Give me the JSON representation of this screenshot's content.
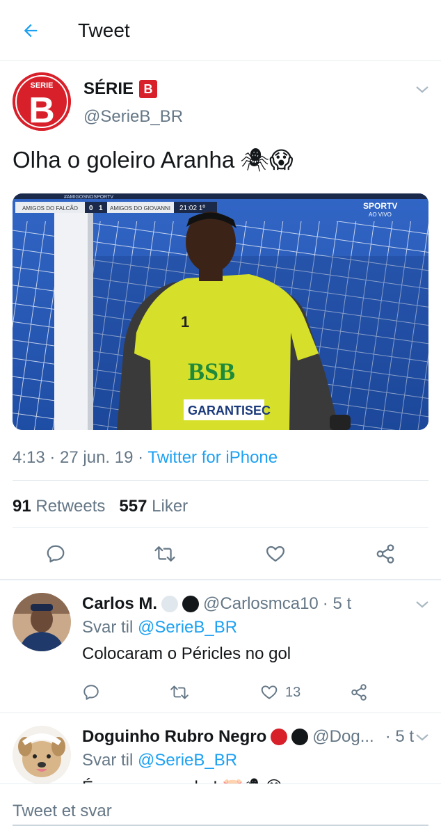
{
  "header": {
    "title": "Tweet"
  },
  "tweet": {
    "author_name": "SÉRIE",
    "author_badge": "B",
    "avatar_text_top": "SERIE",
    "avatar_text_letter": "B",
    "handle": "@SerieB_BR",
    "text": "Olha o goleiro Aranha",
    "emoji": "🕷😱",
    "media": {
      "banner": "#AMIGOSNOSPORTV",
      "team_home": "AMIGOS DO FALCÃO",
      "score_home": "0",
      "score_away": "1",
      "team_away": "AMIGOS DO GIOVANNI",
      "clock": "21:02 1º",
      "channel": "SPORTV",
      "channel_sub": "AO VIVO",
      "shirt_number": "1",
      "shirt_sponsor": "BSB",
      "shirt_sponsor2": "GARANTISEC",
      "colors": {
        "field": "#2a5ab8",
        "shirt": "#d6e02a"
      }
    },
    "time": "4:13 · 27 jun. 19 · ",
    "source": "Twitter for iPhone",
    "retweets_count": "91",
    "retweets_label": "Retweets",
    "likes_count": "557",
    "likes_label": "Liker"
  },
  "replies": [
    {
      "name": "Carlos M.",
      "handle": "@Carlosmca10",
      "time": "· 5 t",
      "reply_to_prefix": "Svar til ",
      "reply_to_handle": "@SerieB_BR",
      "text": "Colocaram o Péricles no gol",
      "like_count": "13"
    },
    {
      "name": "Doguinho Rubro Negro",
      "handle": "@Dog...",
      "time": "· 5 t",
      "reply_to_prefix": "Svar til ",
      "reply_to_handle": "@SerieB_BR",
      "text": "É o nosso aranha! 🐷🕷😂"
    }
  ],
  "reply_bar": {
    "placeholder": "Tweet et svar"
  },
  "colors": {
    "accent": "#1da1f2",
    "muted": "#657786",
    "brand": "#d8202a"
  }
}
